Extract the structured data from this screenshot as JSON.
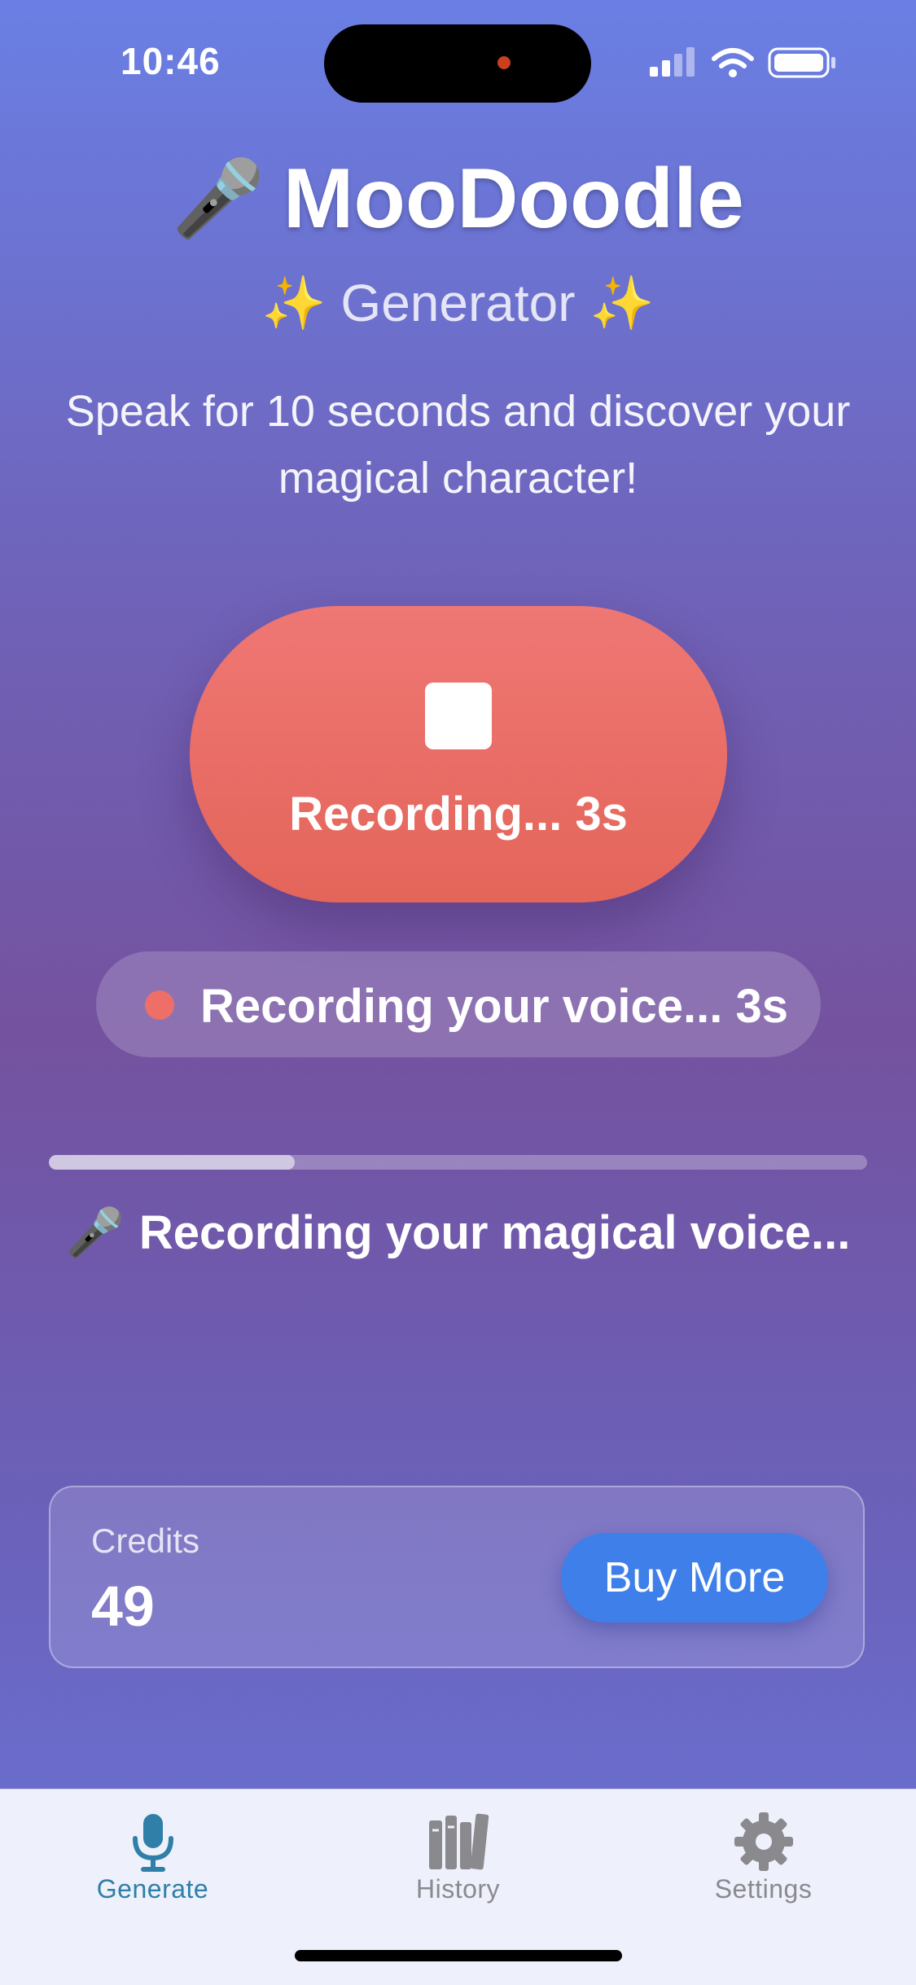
{
  "status_bar": {
    "time": "10:46"
  },
  "header": {
    "emoji": "🎤",
    "title": "MooDoodle",
    "subtitle_spark": "✨",
    "subtitle": "Generator",
    "description": "Speak for 10 seconds and discover your magical character!"
  },
  "record_button": {
    "label": "Recording... 3s",
    "icon": "stop-icon"
  },
  "status_pill": {
    "text": "Recording your voice... 3s",
    "dot_color": "#ee6f68"
  },
  "progress": {
    "value": 0.3
  },
  "recording_message": {
    "emoji": "🎤",
    "text": "Recording your magical voice..."
  },
  "credits": {
    "label": "Credits",
    "value": "49",
    "buy_label": "Buy More"
  },
  "tab_bar": {
    "tabs": [
      {
        "label": "Generate",
        "icon": "microphone-icon",
        "active": true
      },
      {
        "label": "History",
        "icon": "books-icon",
        "active": false
      },
      {
        "label": "Settings",
        "icon": "gear-icon",
        "active": false
      }
    ]
  },
  "colors": {
    "accent": "#3f7fe9",
    "record": "#e96d66",
    "active_tab": "#2f7fa8",
    "inactive_tab": "#8a8a8e"
  }
}
